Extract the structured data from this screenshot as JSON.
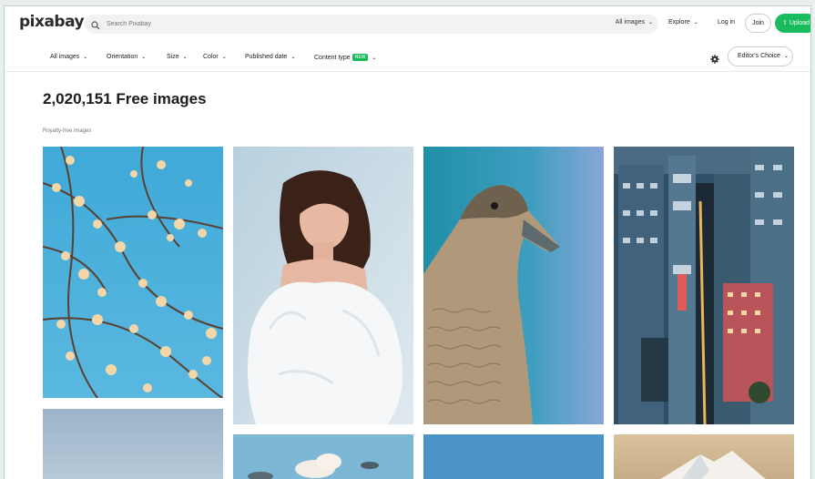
{
  "brand": {
    "logo": "pixabay"
  },
  "search": {
    "placeholder": "Search Pixabay",
    "filter_label": "All images"
  },
  "nav": {
    "explore": "Explore",
    "login": "Log in",
    "join": "Join",
    "upload": "Upload"
  },
  "filters": {
    "all_images": "All images",
    "orientation": "Orientation",
    "size": "Size",
    "color": "Color",
    "published_date": "Published date",
    "content_type": "Content type",
    "new_badge": "NEW",
    "editors_choice": "Editor's Choice"
  },
  "main": {
    "title": "2,020,151 Free images",
    "subtitle": "Royalty-free images"
  },
  "colors": {
    "accent": "#19bb5c",
    "text": "#191b26",
    "frame": "#bfcfcc"
  },
  "images": [
    {
      "name": "blossom-branches-photo",
      "description_icon": "photo"
    },
    {
      "name": "woman-portrait-photo",
      "description_icon": "photo"
    },
    {
      "name": "duck-photo",
      "description_icon": "photo"
    },
    {
      "name": "city-street-photo",
      "description_icon": "photo"
    },
    {
      "name": "sky-photo",
      "description_icon": "photo"
    },
    {
      "name": "clouds-photo",
      "description_icon": "photo"
    },
    {
      "name": "blue-sky-photo",
      "description_icon": "photo"
    },
    {
      "name": "mountain-peak-photo",
      "description_icon": "photo"
    }
  ]
}
